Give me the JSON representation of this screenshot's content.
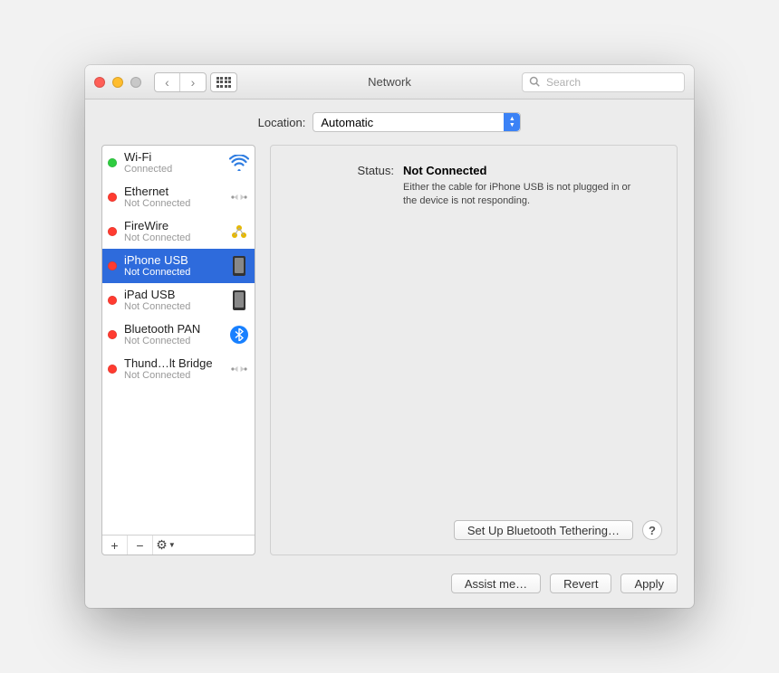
{
  "window": {
    "title": "Network",
    "search_placeholder": "Search"
  },
  "location": {
    "label": "Location:",
    "value": "Automatic"
  },
  "interfaces": [
    {
      "name": "Wi-Fi",
      "status": "Connected",
      "dot": "green",
      "icon": "wifi",
      "selected": false
    },
    {
      "name": "Ethernet",
      "status": "Not Connected",
      "dot": "red",
      "icon": "ethernet",
      "selected": false
    },
    {
      "name": "FireWire",
      "status": "Not Connected",
      "dot": "red",
      "icon": "firewire",
      "selected": false
    },
    {
      "name": "iPhone USB",
      "status": "Not Connected",
      "dot": "red",
      "icon": "phone",
      "selected": true
    },
    {
      "name": "iPad USB",
      "status": "Not Connected",
      "dot": "red",
      "icon": "phone",
      "selected": false
    },
    {
      "name": "Bluetooth PAN",
      "status": "Not Connected",
      "dot": "red",
      "icon": "bluetooth",
      "selected": false
    },
    {
      "name": "Thund…lt Bridge",
      "status": "Not Connected",
      "dot": "red",
      "icon": "ethernet",
      "selected": false
    }
  ],
  "detail": {
    "status_label": "Status:",
    "status_value": "Not Connected",
    "message": "Either the cable for iPhone USB is not plugged in or the device is not responding.",
    "setup_button": "Set Up Bluetooth Tethering…",
    "help": "?"
  },
  "buttons": {
    "assist": "Assist me…",
    "revert": "Revert",
    "apply": "Apply"
  },
  "sidebar_footer": {
    "add": "+",
    "remove": "−",
    "action": "⚙︎▾"
  }
}
